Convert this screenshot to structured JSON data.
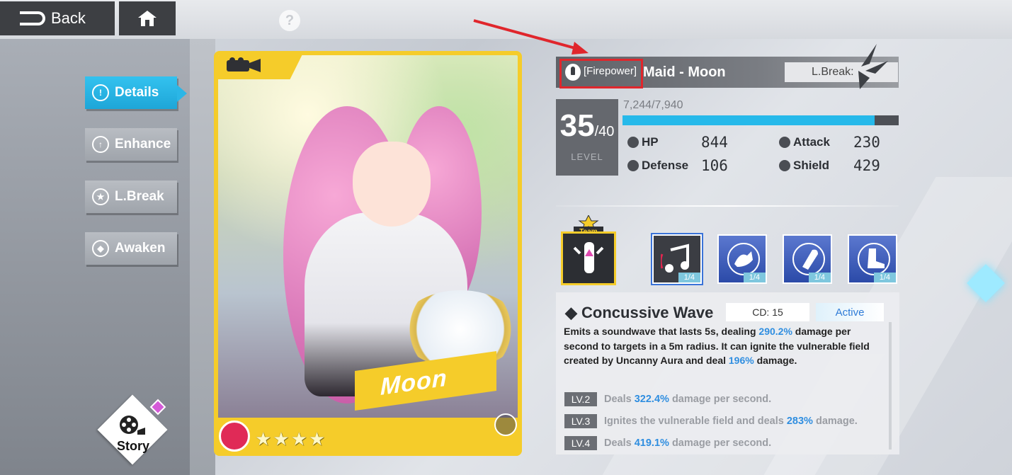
{
  "topbar": {
    "back_label": "Back",
    "help_label": "?"
  },
  "menu": {
    "items": [
      {
        "label": "Details",
        "icon": "exclamation-icon",
        "active": true
      },
      {
        "label": "Enhance",
        "icon": "arrow-up-icon",
        "active": false
      },
      {
        "label": "L.Break",
        "icon": "star-icon",
        "active": false
      },
      {
        "label": "Awaken",
        "icon": "diamond-icon",
        "active": false
      }
    ]
  },
  "story": {
    "label": "Story"
  },
  "card": {
    "banner": "Moon",
    "rarity_stars": "★★★★"
  },
  "character": {
    "class": "[Firepower]",
    "name": "Maid - Moon",
    "lbreak_label": "L.Break:",
    "level": "35",
    "level_max": "/40",
    "level_label": "LEVEL",
    "exp_text": "7,244/7,940",
    "exp_fraction": 0.912,
    "stats": {
      "hp_label": "HP",
      "hp": "844",
      "attack_label": "Attack",
      "attack": "230",
      "defense_label": "Defense",
      "defense": "106",
      "shield_label": "Shield",
      "shield": "429"
    }
  },
  "team_badge": "Team",
  "skills": [
    {
      "icon": "music-note-icon",
      "count": "1/4"
    },
    {
      "icon": "arm-up-icon",
      "count": "1/4"
    },
    {
      "icon": "bullet-icon",
      "count": "1/4"
    },
    {
      "icon": "boot-icon",
      "count": "1/4"
    }
  ],
  "skill_detail": {
    "title": "Concussive Wave",
    "cd": "CD: 15",
    "type": "Active",
    "desc_1": "Emits a soundwave that lasts 5s, dealing ",
    "desc_val_1": "290.2%",
    "desc_2": " damage per second to targets in a 5m radius. It can ignite the vulnerable field created by Uncanny Aura and deal ",
    "desc_val_2": "196%",
    "desc_3": " damage.",
    "levels": [
      {
        "tag": "LV.2",
        "pre": "Deals ",
        "val": "322.4%",
        "post": " damage per second."
      },
      {
        "tag": "LV.3",
        "pre": "Ignites the vulnerable field and deals ",
        "val": "283%",
        "post": " damage."
      },
      {
        "tag": "LV.4",
        "pre": "Deals ",
        "val": "419.1%",
        "post": " damage per second."
      }
    ]
  },
  "colors": {
    "accent": "#26b9ea",
    "card_gold": "#f5cc2a",
    "highlight": "#e0262c"
  }
}
